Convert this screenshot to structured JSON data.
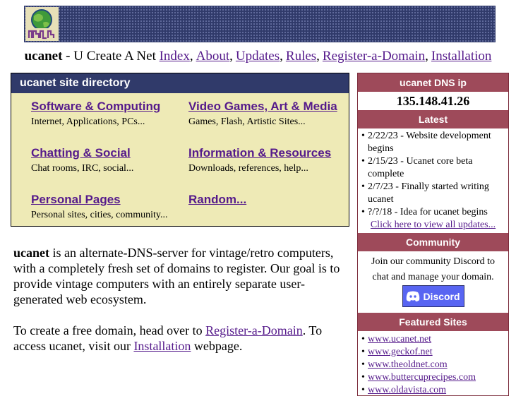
{
  "banner": {
    "logo_alt": "ucanet logo"
  },
  "nav": {
    "brand": "ucanet",
    "tagline": " - U Create A Net ",
    "links": [
      {
        "label": "Index",
        "sep": ","
      },
      {
        "label": "About",
        "sep": ","
      },
      {
        "label": "Updates",
        "sep": ","
      },
      {
        "label": "Rules",
        "sep": ","
      },
      {
        "label": "Register-a-Domain",
        "sep": ","
      },
      {
        "label": "Installation",
        "sep": ""
      }
    ]
  },
  "directory": {
    "title": "ucanet site directory",
    "categories": [
      {
        "label": "Software & Computing",
        "desc": "Internet, Applications, PCs..."
      },
      {
        "label": "Video Games, Art & Media",
        "desc": "Games, Flash, Artistic Sites..."
      },
      {
        "label": "Chatting & Social",
        "desc": "Chat rooms, IRC, social..."
      },
      {
        "label": "Information & Resources",
        "desc": "Downloads, references, help..."
      },
      {
        "label": "Personal Pages",
        "desc": "Personal sites, cities, community..."
      },
      {
        "label": "Random...",
        "desc": ""
      }
    ]
  },
  "intro": {
    "brand": "ucanet",
    "p1_rest": " is an alternate-DNS-server for vintage/retro computers, with a completely fresh set of domains to register. Our goal is to provide vintage computers with an entirely separate user-generated web ecosystem.",
    "p2_a": "To create a free domain, head over to ",
    "p2_link1": "Register-a-Domain",
    "p2_b": ". To access ucanet, visit our ",
    "p2_link2": "Installation",
    "p2_c": " webpage."
  },
  "sidebar": {
    "dns_title": "ucanet DNS ip",
    "dns_ip": "135.148.41.26",
    "latest_title": "Latest",
    "latest": [
      "2/22/23 - Website development begins",
      "2/15/23 - Ucanet core beta complete",
      "2/7/23 - Finally started writing ucanet",
      "?/?/18 - Idea for ucanet begins"
    ],
    "view_all": "Click here to view all updates...",
    "community_title": "Community",
    "community_text": "Join our community Discord to chat and manage your domain.",
    "discord_label": "Discord",
    "featured_title": "Featured Sites",
    "featured": [
      "www.ucanet.net",
      "www.geckof.net",
      "www.theoldnet.com",
      "www.buttercuprecipes.com",
      "www.oldavista.com"
    ]
  },
  "colors": {
    "banner": "#303a6a",
    "directory_bg": "#eeeab6",
    "sidebar_header": "#9e4a5a",
    "link": "#551a8b",
    "discord": "#5865f2"
  }
}
